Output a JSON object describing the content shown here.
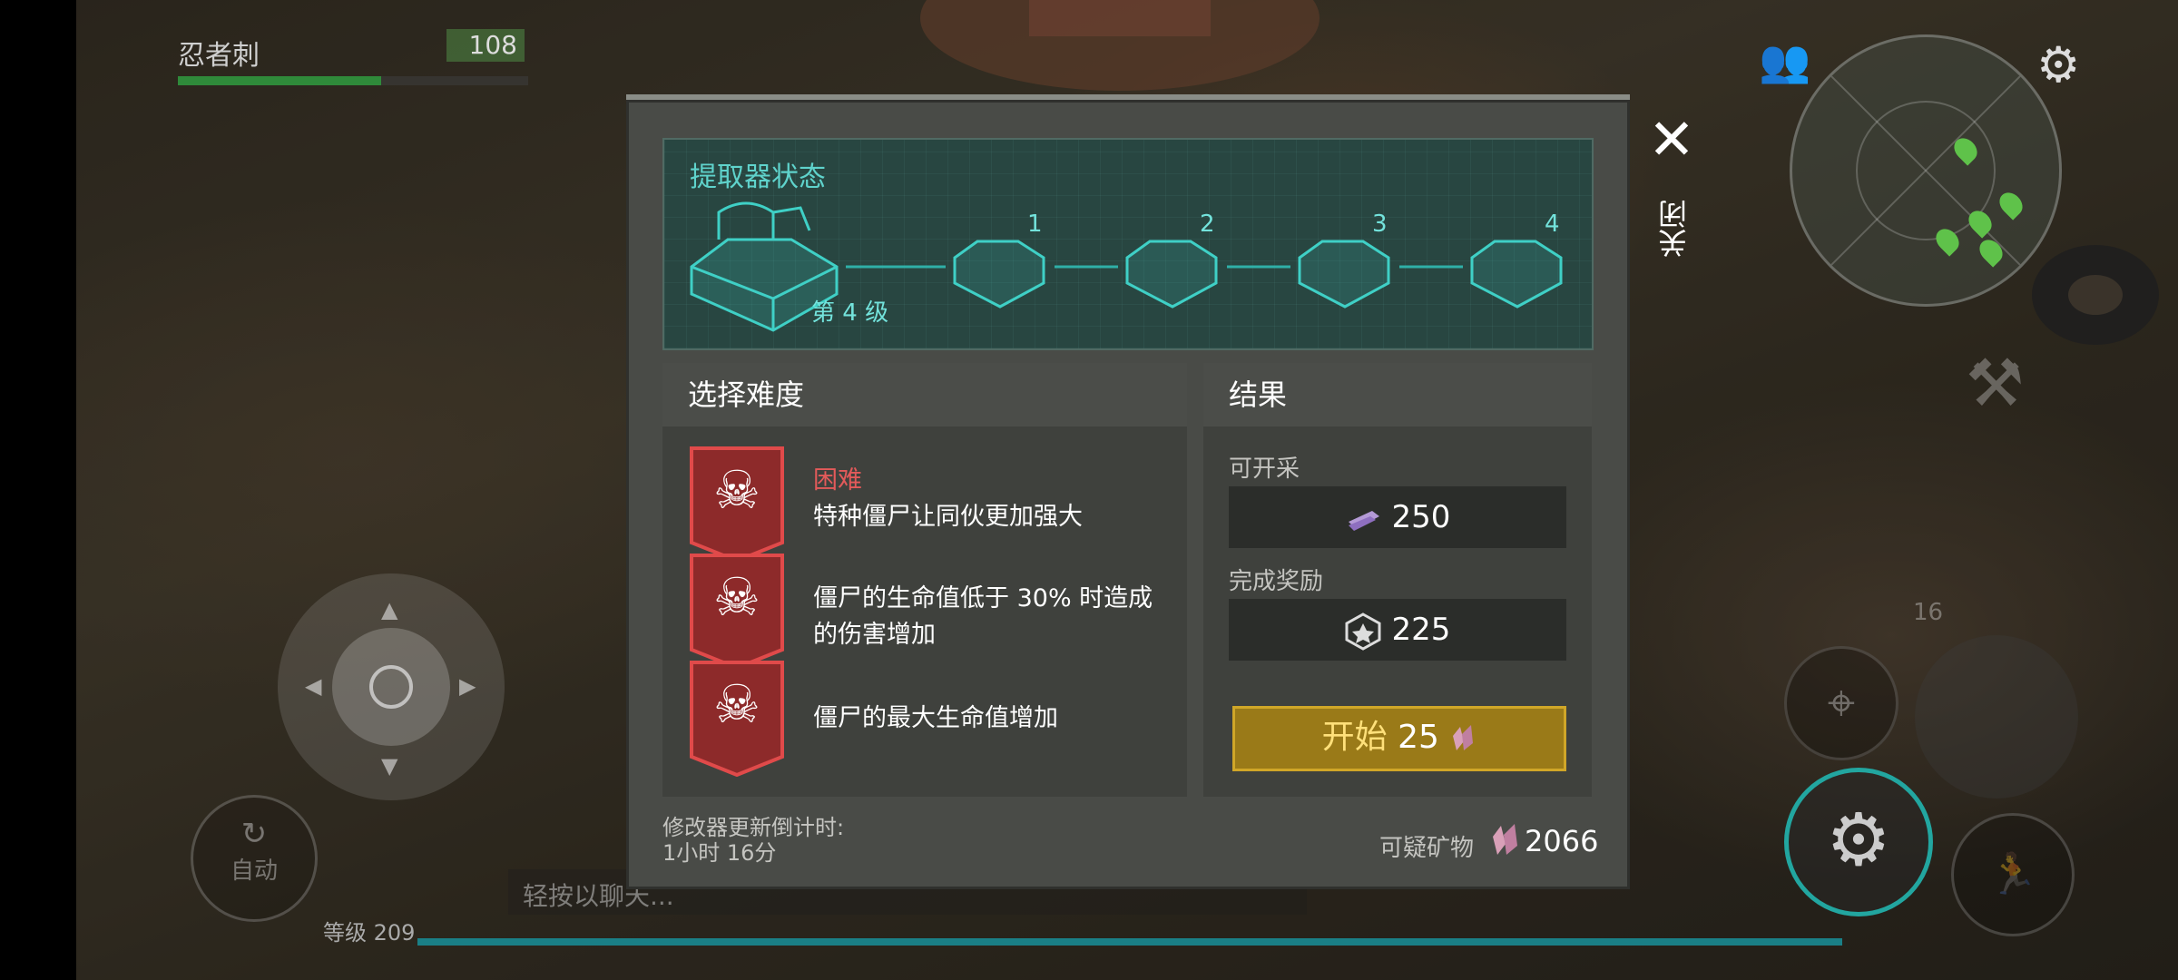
{
  "hud": {
    "player_name": "忍者刺",
    "player_value": "108",
    "health_fraction": 0.58,
    "chat_placeholder": "轻按以聊天...",
    "level_label": "等级 209",
    "xp_fraction": 1.0,
    "auto_label": "自动",
    "pickaxe_count": "16",
    "icons": [
      "friends-icon",
      "settings-icon",
      "crafting-icon",
      "aim-icon",
      "action-gear-icon",
      "sprint-icon",
      "auto-icon"
    ]
  },
  "dialog": {
    "close_label": "关闭",
    "extractor": {
      "title": "提取器状态",
      "current_level_label": "第 4 级",
      "stages": [
        "1",
        "2",
        "3",
        "4"
      ]
    },
    "difficulty": {
      "header": "选择难度",
      "modifiers": [
        {
          "title": "困难",
          "description": "特种僵尸让同伙更加强大",
          "icon": "skull-plus-icon"
        },
        {
          "title": "",
          "description": "僵尸的生命值低于 30% 时造成的伤害增加",
          "icon": "skull-burst-icon"
        },
        {
          "title": "",
          "description": "僵尸的最大生命值增加",
          "icon": "skull-shield-icon"
        }
      ]
    },
    "result": {
      "header": "结果",
      "minable_label": "可开采",
      "minable_value": "250",
      "reward_label": "完成奖励",
      "reward_value": "225",
      "start_label": "开始",
      "start_cost": "25"
    },
    "timer_label": "修改器更新倒计时:",
    "timer_value": "1小时 16分",
    "ore_label": "可疑矿物",
    "ore_value": "2066"
  },
  "colors": {
    "accent_teal": "#5fd3cc",
    "danger_red": "#e35a5a",
    "start_gold": "#9a7a18",
    "xp_teal": "#1a7f86",
    "health_green": "#2f8a3a"
  }
}
